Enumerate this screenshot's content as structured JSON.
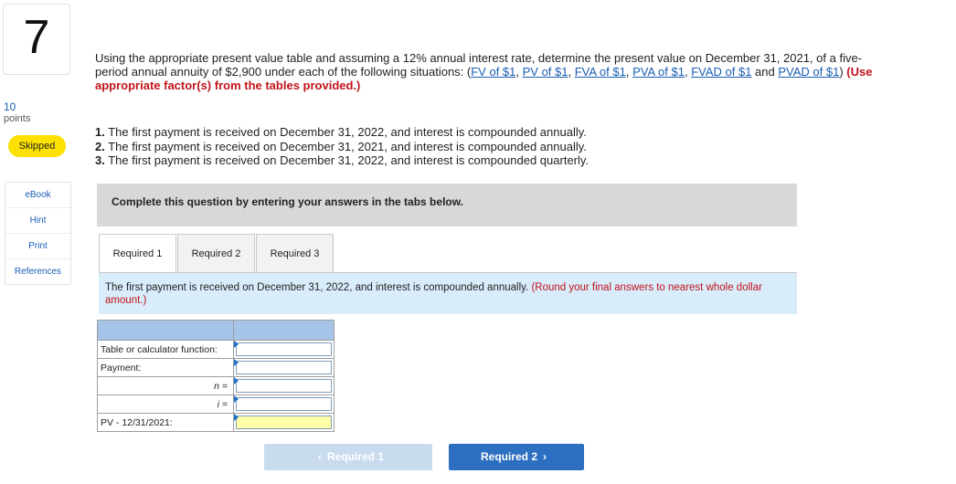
{
  "question": {
    "number": "7",
    "points_value": "10",
    "points_label": "points",
    "status": "Skipped",
    "prompt_text": "Using the appropriate present value table and assuming a 12% annual interest rate, determine the present value on December 31, 2021, of a five-period annual annuity of $2,900 under each of the following situations: (",
    "links": [
      "FV of $1",
      "PV of $1",
      "FVA of $1",
      "PVA of $1",
      "FVAD of $1"
    ],
    "and_text": " and ",
    "last_link": "PVAD of $1",
    "close_paren": ") ",
    "instruction_bold": "(Use appropriate factor(s) from the tables provided.)",
    "parts": [
      {
        "num": "1.",
        "text": " The first payment is received on December 31, 2022, and interest is compounded annually."
      },
      {
        "num": "2.",
        "text": " The first payment is received on December 31, 2021, and interest is compounded annually."
      },
      {
        "num": "3.",
        "text": " The first payment is received on December 31, 2022, and interest is compounded quarterly."
      }
    ]
  },
  "sidebar": {
    "links": [
      "eBook",
      "Hint",
      "Print",
      "References"
    ]
  },
  "banner": "Complete this question by entering your answers in the tabs below.",
  "tabs": [
    "Required 1",
    "Required 2",
    "Required 3"
  ],
  "instruction": {
    "text": "The first payment is received on December 31, 2022, and interest is compounded annually. ",
    "red": "(Round your final answers to nearest whole dollar amount.)"
  },
  "table": {
    "rows": [
      {
        "label": "Table or calculator function:",
        "value": ""
      },
      {
        "label": "Payment:",
        "value": ""
      },
      {
        "label": "n =",
        "value": ""
      },
      {
        "label": "i =",
        "value": ""
      },
      {
        "label": "PV - 12/31/2021:",
        "value": ""
      }
    ]
  },
  "nav": {
    "prev_label": "Required 1",
    "next_label": "Required 2"
  },
  "colors": {
    "accent": "#2d6fc1",
    "status_badge": "#fde100",
    "instruction_bg": "#d9ecfa",
    "table_header": "#a5c4e8",
    "answer_highlight": "#ffffa8"
  }
}
